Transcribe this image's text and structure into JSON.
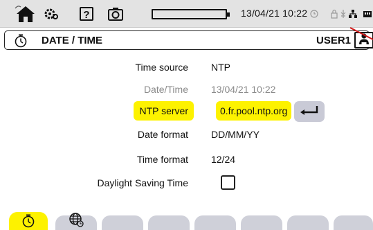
{
  "status_bar": {
    "datetime": "13/04/21 10:22",
    "icons": [
      "home-icon",
      "gear-icon",
      "help-icon",
      "camera-icon",
      "battery-icon",
      "clock-status-icon",
      "lock-icon",
      "usb-icon",
      "network-icon",
      "sd-card-icon"
    ]
  },
  "title_bar": {
    "title": "DATE / TIME",
    "user": "USER1",
    "icons": [
      "stopwatch-icon",
      "user-icon"
    ]
  },
  "settings": {
    "time_source": {
      "label": "Time source",
      "value": "NTP"
    },
    "date_time": {
      "label": "Date/Time",
      "value": "13/04/21 10:22"
    },
    "ntp_server": {
      "label": "NTP server",
      "value": "0.fr.pool.ntp.org"
    },
    "date_format": {
      "label": "Date format",
      "value": "DD/MM/YY"
    },
    "time_format": {
      "label": "Time format",
      "value": "12/24"
    },
    "dst": {
      "label": "Daylight Saving Time",
      "checked": false
    }
  },
  "tabs": {
    "items": [
      "stopwatch-tab-icon",
      "globe-tab-icon",
      "",
      "",
      "",
      "",
      "",
      ""
    ],
    "active_index": 0
  },
  "colors": {
    "highlight": "#fdf200",
    "tab": "#cfd0d9",
    "status_bar": "#e3e3e3",
    "annotation": "#d11a1a"
  }
}
